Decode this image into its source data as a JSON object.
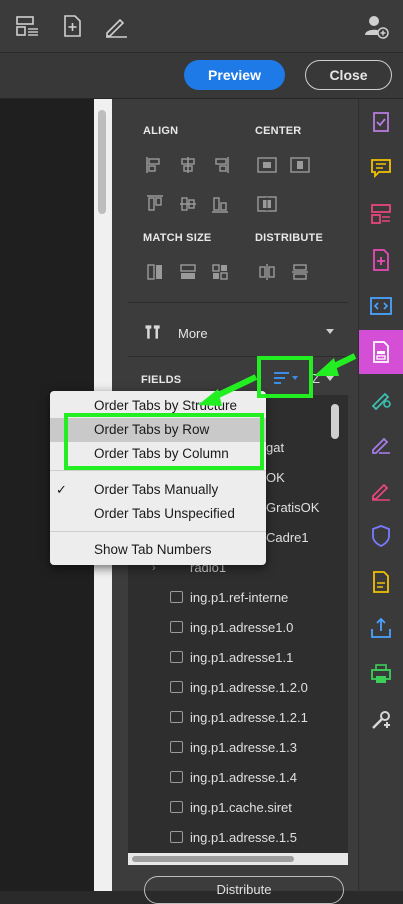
{
  "toolbar": {
    "icons": [
      "page-layout-icon",
      "document-add-icon",
      "edit-pen-icon",
      "add-user-icon"
    ],
    "preview_label": "Preview",
    "close_label": "Close"
  },
  "panel": {
    "align_label": "ALIGN",
    "center_label": "CENTER",
    "match_size_label": "MATCH SIZE",
    "distribute_label": "DISTRIBUTE",
    "more_label": "More",
    "fields_label": "FIELDS",
    "distribute_button": "Distribute"
  },
  "fields": {
    "partial": [
      "gat",
      "OK",
      "GratisOK",
      "Cadre1",
      "radio1"
    ],
    "items": [
      "ing.p1.ref-interne",
      "ing.p1.adresse1.0",
      "ing.p1.adresse1.1",
      "ing.p1.adresse.1.2.0",
      "ing.p1.adresse.1.2.1",
      "ing.p1.adresse.1.3",
      "ing.p1.adresse.1.4",
      "ing.p1.cache.siret",
      "ing.p1.adresse.1.5"
    ]
  },
  "menu": {
    "items": [
      "Order Tabs by Structure",
      "Order Tabs by Row",
      "Order Tabs by Column",
      "Order Tabs Manually",
      "Order Tabs Unspecified",
      "Show Tab Numbers"
    ],
    "check": "✓"
  },
  "rail": {
    "icons": [
      "checklist-icon",
      "comment-icon",
      "organize-pages-icon",
      "create-pdf-icon",
      "code-icon",
      "prepare-form-icon",
      "fill-sign-icon",
      "signature-icon",
      "sign-pen-icon",
      "protect-shield-icon",
      "export-doc-icon",
      "share-icon",
      "print-production-icon",
      "tools-icon"
    ],
    "active_color": "#d54fd6"
  },
  "colors": {
    "accent": "#1d7ae6",
    "highlight": "#22ee22"
  }
}
